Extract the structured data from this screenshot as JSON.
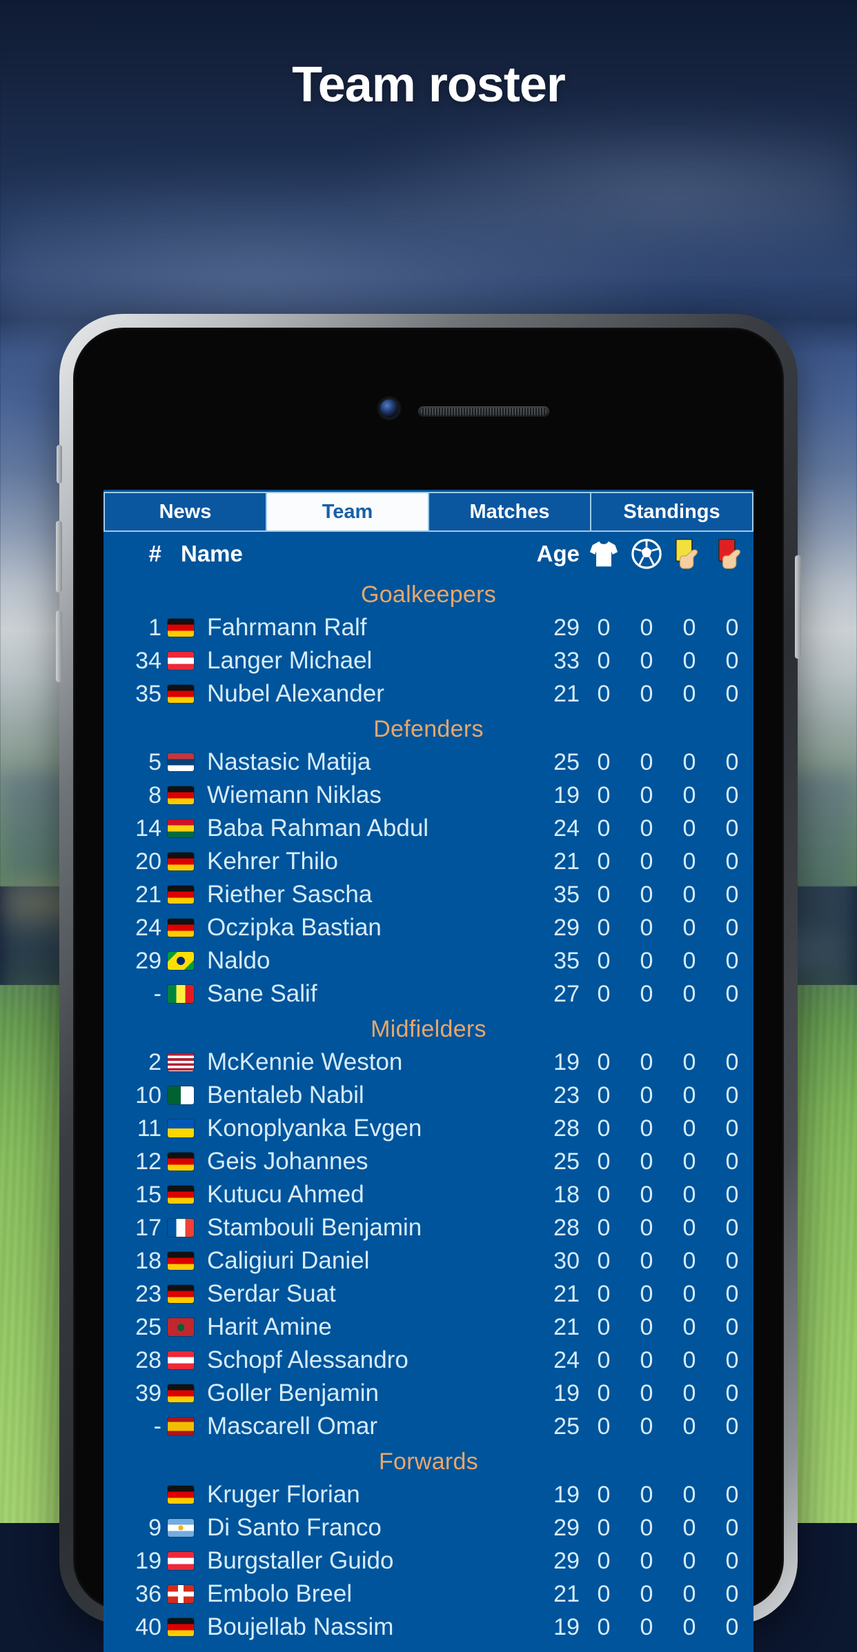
{
  "page_title": "Team roster",
  "colors": {
    "app_blue": "#00549b",
    "tab_active_bg": "#ffffff",
    "tab_active_text": "#1560a8",
    "section_heading": "#e8a76a",
    "row_text": "#d5ecfa",
    "yellow_card": "#f2e03c",
    "red_card": "#e02020"
  },
  "tabs": [
    {
      "label": "News",
      "active": false
    },
    {
      "label": "Team",
      "active": true
    },
    {
      "label": "Matches",
      "active": false
    },
    {
      "label": "Standings",
      "active": false
    }
  ],
  "table_header": {
    "number": "#",
    "name": "Name",
    "age": "Age",
    "icons": [
      "shirt-icon",
      "soccer-ball-icon",
      "yellow-card-icon",
      "red-card-icon"
    ]
  },
  "sections": [
    {
      "title": "Goalkeepers",
      "players": [
        {
          "number": "1",
          "flag": "Germany",
          "name": "Fahrmann Ralf",
          "age": "29",
          "apps": "0",
          "goals": "0",
          "yellow": "0",
          "red": "0"
        },
        {
          "number": "34",
          "flag": "Austria",
          "name": "Langer Michael",
          "age": "33",
          "apps": "0",
          "goals": "0",
          "yellow": "0",
          "red": "0"
        },
        {
          "number": "35",
          "flag": "Germany",
          "name": "Nubel Alexander",
          "age": "21",
          "apps": "0",
          "goals": "0",
          "yellow": "0",
          "red": "0"
        }
      ]
    },
    {
      "title": "Defenders",
      "players": [
        {
          "number": "5",
          "flag": "Serbia",
          "name": "Nastasic Matija",
          "age": "25",
          "apps": "0",
          "goals": "0",
          "yellow": "0",
          "red": "0"
        },
        {
          "number": "8",
          "flag": "Germany",
          "name": "Wiemann Niklas",
          "age": "19",
          "apps": "0",
          "goals": "0",
          "yellow": "0",
          "red": "0"
        },
        {
          "number": "14",
          "flag": "Ghana",
          "name": "Baba Rahman Abdul",
          "age": "24",
          "apps": "0",
          "goals": "0",
          "yellow": "0",
          "red": "0"
        },
        {
          "number": "20",
          "flag": "Germany",
          "name": "Kehrer Thilo",
          "age": "21",
          "apps": "0",
          "goals": "0",
          "yellow": "0",
          "red": "0"
        },
        {
          "number": "21",
          "flag": "Germany",
          "name": "Riether Sascha",
          "age": "35",
          "apps": "0",
          "goals": "0",
          "yellow": "0",
          "red": "0"
        },
        {
          "number": "24",
          "flag": "Germany",
          "name": "Oczipka Bastian",
          "age": "29",
          "apps": "0",
          "goals": "0",
          "yellow": "0",
          "red": "0"
        },
        {
          "number": "29",
          "flag": "Brazil",
          "name": "Naldo",
          "age": "35",
          "apps": "0",
          "goals": "0",
          "yellow": "0",
          "red": "0"
        },
        {
          "number": "-",
          "flag": "Senegal",
          "name": "Sane Salif",
          "age": "27",
          "apps": "0",
          "goals": "0",
          "yellow": "0",
          "red": "0"
        }
      ]
    },
    {
      "title": "Midfielders",
      "players": [
        {
          "number": "2",
          "flag": "USA",
          "name": "McKennie Weston",
          "age": "19",
          "apps": "0",
          "goals": "0",
          "yellow": "0",
          "red": "0"
        },
        {
          "number": "10",
          "flag": "Algeria",
          "name": "Bentaleb Nabil",
          "age": "23",
          "apps": "0",
          "goals": "0",
          "yellow": "0",
          "red": "0"
        },
        {
          "number": "11",
          "flag": "Ukraine",
          "name": "Konoplyanka Evgen",
          "age": "28",
          "apps": "0",
          "goals": "0",
          "yellow": "0",
          "red": "0"
        },
        {
          "number": "12",
          "flag": "Germany",
          "name": "Geis Johannes",
          "age": "25",
          "apps": "0",
          "goals": "0",
          "yellow": "0",
          "red": "0"
        },
        {
          "number": "15",
          "flag": "Germany",
          "name": "Kutucu Ahmed",
          "age": "18",
          "apps": "0",
          "goals": "0",
          "yellow": "0",
          "red": "0"
        },
        {
          "number": "17",
          "flag": "France",
          "name": "Stambouli Benjamin",
          "age": "28",
          "apps": "0",
          "goals": "0",
          "yellow": "0",
          "red": "0"
        },
        {
          "number": "18",
          "flag": "Germany",
          "name": "Caligiuri Daniel",
          "age": "30",
          "apps": "0",
          "goals": "0",
          "yellow": "0",
          "red": "0"
        },
        {
          "number": "23",
          "flag": "Germany",
          "name": "Serdar Suat",
          "age": "21",
          "apps": "0",
          "goals": "0",
          "yellow": "0",
          "red": "0"
        },
        {
          "number": "25",
          "flag": "Morocco",
          "name": "Harit Amine",
          "age": "21",
          "apps": "0",
          "goals": "0",
          "yellow": "0",
          "red": "0"
        },
        {
          "number": "28",
          "flag": "Austria",
          "name": "Schopf Alessandro",
          "age": "24",
          "apps": "0",
          "goals": "0",
          "yellow": "0",
          "red": "0"
        },
        {
          "number": "39",
          "flag": "Germany",
          "name": "Goller Benjamin",
          "age": "19",
          "apps": "0",
          "goals": "0",
          "yellow": "0",
          "red": "0"
        },
        {
          "number": "-",
          "flag": "Spain",
          "name": "Mascarell Omar",
          "age": "25",
          "apps": "0",
          "goals": "0",
          "yellow": "0",
          "red": "0"
        }
      ]
    },
    {
      "title": "Forwards",
      "players": [
        {
          "number": "",
          "flag": "Germany",
          "name": "Kruger Florian",
          "age": "19",
          "apps": "0",
          "goals": "0",
          "yellow": "0",
          "red": "0"
        },
        {
          "number": "9",
          "flag": "Argentina",
          "name": "Di Santo Franco",
          "age": "29",
          "apps": "0",
          "goals": "0",
          "yellow": "0",
          "red": "0"
        },
        {
          "number": "19",
          "flag": "Austria",
          "name": "Burgstaller Guido",
          "age": "29",
          "apps": "0",
          "goals": "0",
          "yellow": "0",
          "red": "0"
        },
        {
          "number": "36",
          "flag": "Switzerland",
          "name": "Embolo Breel",
          "age": "21",
          "apps": "0",
          "goals": "0",
          "yellow": "0",
          "red": "0"
        },
        {
          "number": "40",
          "flag": "Germany",
          "name": "Boujellab Nassim",
          "age": "19",
          "apps": "0",
          "goals": "0",
          "yellow": "0",
          "red": "0"
        }
      ]
    }
  ]
}
